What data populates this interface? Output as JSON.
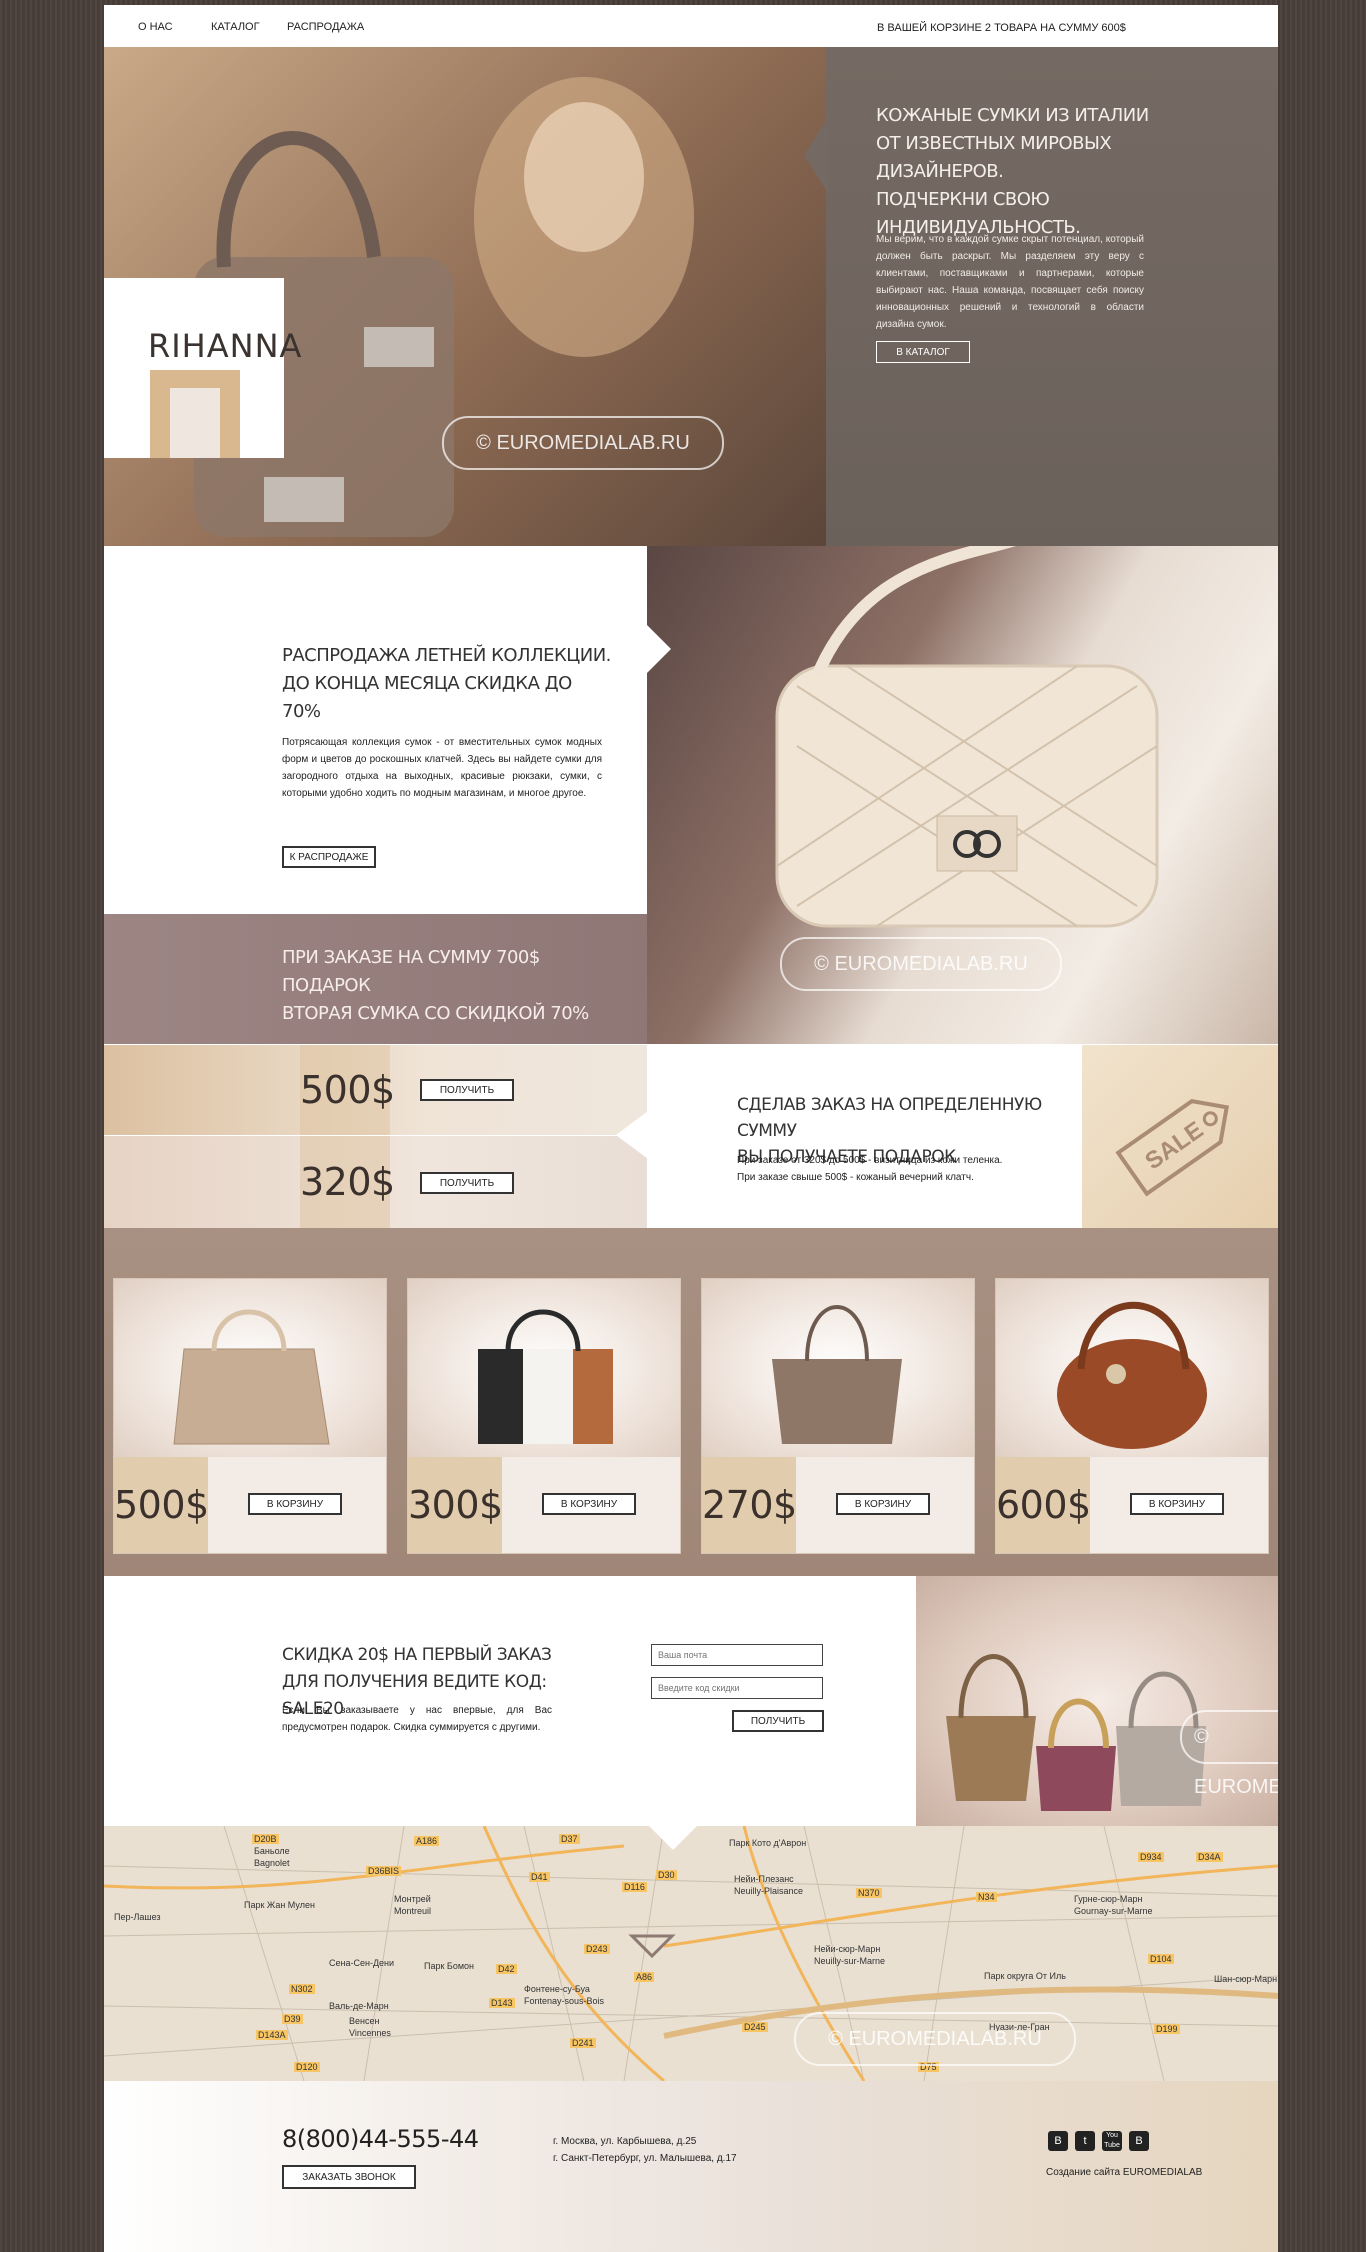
{
  "nav": {
    "items": [
      "О НАС",
      "КАТАЛОГ",
      "РАСПРОДАЖА"
    ],
    "cart": "В ВАШЕЙ КОРЗИНЕ 2 ТОВАРА НА СУММУ 600$"
  },
  "hero": {
    "logo": "RIHANNA",
    "title_lines": [
      "КОЖАНЫЕ СУМКИ ИЗ ИТАЛИИ",
      "ОТ ИЗВЕСТНЫХ МИРОВЫХ ДИЗАЙНЕРОВ.",
      "ПОДЧЕРКНИ СВОЮ ИНДИВИДУАЛЬНОСТЬ."
    ],
    "text": "Мы верим, что в каждой сумке скрыт потенциал, который должен быть раскрыт. Мы разделяем эту веру с клиентами, поставщиками и партнерами, которые выбирают нас. Наша команда, посвящает себя поиску инновационных решений и технологий в области дизайна сумок.",
    "button": "В КАТАЛОГ",
    "watermark": "© EUROMEDIALAB.RU"
  },
  "sale": {
    "title_lines": [
      "РАСПРОДАЖА ЛЕТНЕЙ КОЛЛЕКЦИИ.",
      "ДО КОНЦА МЕСЯЦА СКИДКА ДО 70%"
    ],
    "text": "Потрясающая коллекция сумок - от вместительных сумок модных форм и цветов до роскошных клатчей. Здесь вы найдете сумки для загородного отдыха на выходных, красивые рюкзаки, сумки, с которыми удобно ходить по модным магазинам, и многое другое.",
    "button": "К РАСПРОДАЖЕ",
    "watermark": "© EUROMEDIALAB.RU",
    "gift_lines": [
      "ПРИ ЗАКАЗЕ НА СУММУ 700$ ПОДАРОК",
      "ВТОРАЯ СУМКА СО СКИДКОЙ 70%"
    ]
  },
  "offers": {
    "rows": [
      {
        "price": "500$",
        "button": "ПОЛУЧИТЬ"
      },
      {
        "price": "320$",
        "button": "ПОЛУЧИТЬ"
      }
    ],
    "title_lines": [
      "СДЕЛАВ ЗАКАЗ НА ОПРЕДЕЛЕННУЮ СУММУ",
      "ВЫ ПОЛУЧАЕТЕ ПОДАРОК"
    ],
    "text_lines": [
      "При заказе от 320$ до 500$ - визитница из кожи теленка.",
      "При заказе свыше 500$ - кожаный вечерний клатч."
    ],
    "tag": "SALE"
  },
  "products": [
    {
      "price": "500$",
      "button": "В КОРЗИНУ"
    },
    {
      "price": "300$",
      "button": "В КОРЗИНУ"
    },
    {
      "price": "270$",
      "button": "В КОРЗИНУ"
    },
    {
      "price": "600$",
      "button": "В КОРЗИНУ"
    }
  ],
  "promo": {
    "title_lines": [
      "СКИДКА 20$ НА ПЕРВЫЙ ЗАКАЗ",
      "ДЛЯ ПОЛУЧЕНИЯ ВЕДИТЕ КОД: SALE20"
    ],
    "text": "Если Вы заказываете у нас впервые, для Вас предусмотрен подарок. Скидка суммируется с другими.",
    "email_placeholder": "Ваша почта",
    "code_placeholder": "Введите код скидки",
    "button": "ПОЛУЧИТЬ",
    "watermark": "© EUROMEDIAL"
  },
  "map": {
    "labels": [
      "Баньоле",
      "Bagnolet",
      "Монтрей",
      "Montreuil",
      "Парк Жан Мулен",
      "Пер-Лашез",
      "Сена-Сен-Дени",
      "Парк Бомон",
      "Фонтене-су-Буа",
      "Fontenay-sous-Bois",
      "Валь-де-Марн",
      "Венсен",
      "Vincennes",
      "Парк Кото д'Аврон",
      "Нейи-Плезанс",
      "Neuilly-Plaisance",
      "Нейи-сюр-Марн",
      "Neuilly-sur-Marne",
      "Парк округа От Иль",
      "Гурне-сюр-Марн",
      "Gournay-sur-Marne",
      "Шан-сюр-Марн",
      "Нуази-ле-Гран"
    ],
    "roads": [
      "D20B",
      "A186",
      "D37",
      "D36BIS",
      "D41",
      "D30",
      "D116",
      "N370",
      "N34",
      "D934",
      "D34A",
      "D42",
      "D243",
      "D143",
      "D241",
      "D245",
      "D120",
      "D75",
      "D199",
      "D104",
      "A86",
      "N302",
      "D39",
      "D143A"
    ],
    "watermark": "© EUROMEDIALAB.RU"
  },
  "footer": {
    "phone": "8(800)44-555-44",
    "button": "ЗАКАЗАТЬ ЗВОНОК",
    "address_lines": [
      "г. Москва, ул. Карбышева, д.25",
      "г. Санкт-Петербург, ул. Малышева, д.17"
    ],
    "social": [
      "B",
      "t",
      "You Tube",
      "B"
    ],
    "credit": "Создание сайта EUROMEDIALAB"
  },
  "colors": {
    "accent_tan": "#d9b88f",
    "mauve": "#9c8583",
    "taupe": "#a89182",
    "dark_bg": "#4a3f3a"
  }
}
